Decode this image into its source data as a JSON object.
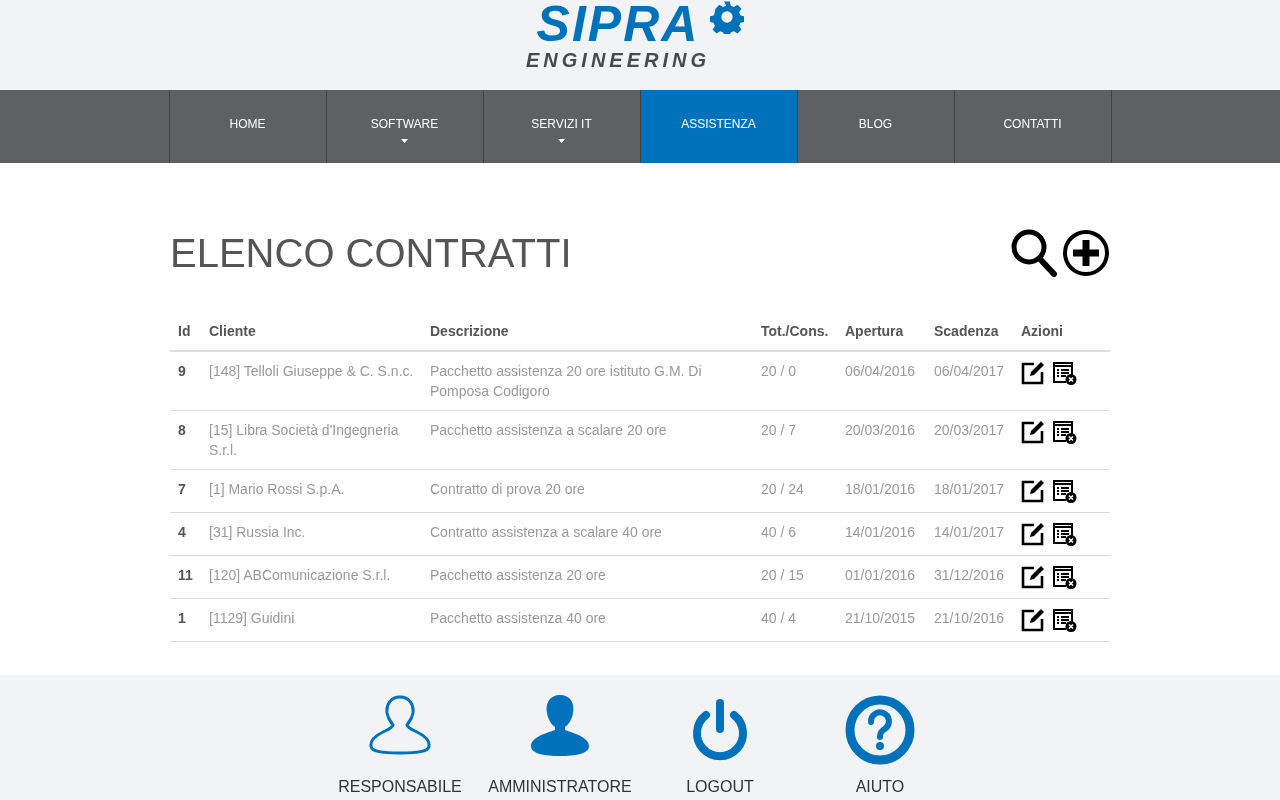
{
  "logo": {
    "name": "SIPRA",
    "tagline": "ENGINEERING"
  },
  "nav": [
    {
      "label": "HOME",
      "has_dropdown": false,
      "selected": false
    },
    {
      "label": "SOFTWARE",
      "has_dropdown": true,
      "selected": false
    },
    {
      "label": "SERVIZI IT",
      "has_dropdown": true,
      "selected": false
    },
    {
      "label": "ASSISTENZA",
      "has_dropdown": false,
      "selected": true
    },
    {
      "label": "BLOG",
      "has_dropdown": false,
      "selected": false
    },
    {
      "label": "CONTATTI",
      "has_dropdown": false,
      "selected": false
    }
  ],
  "page_title": "ELENCO CONTRATTI",
  "table": {
    "columns": [
      "Id",
      "Cliente",
      "Descrizione",
      "Tot./Cons.",
      "Apertura",
      "Scadenza",
      "Azioni"
    ],
    "rows": [
      {
        "id": "9",
        "cliente": "[148] Telloli Giuseppe & C. S.n.c.",
        "descrizione": "Pacchetto assistenza 20 ore istituto G.M. Di Pomposa Codigoro",
        "tot_cons": "20 / 0",
        "apertura": "06/04/2016",
        "scadenza": "06/04/2017"
      },
      {
        "id": "8",
        "cliente": "[15] Libra Società d'Ingegneria S.r.l.",
        "descrizione": "Pacchetto assistenza a scalare 20 ore",
        "tot_cons": "20 / 7",
        "apertura": "20/03/2016",
        "scadenza": "20/03/2017"
      },
      {
        "id": "7",
        "cliente": "[1] Mario Rossi S.p.A.",
        "descrizione": "Contratto di prova 20 ore",
        "tot_cons": "20 / 24",
        "apertura": "18/01/2016",
        "scadenza": "18/01/2017"
      },
      {
        "id": "4",
        "cliente": "[31] Russia Inc.",
        "descrizione": "Contratto assistenza a scalare 40 ore",
        "tot_cons": "40 / 6",
        "apertura": "14/01/2016",
        "scadenza": "14/01/2017"
      },
      {
        "id": "11",
        "cliente": "[120] ABComunicazione S.r.l.",
        "descrizione": "Pacchetto assistenza 20 ore",
        "tot_cons": "20 / 15",
        "apertura": "01/01/2016",
        "scadenza": "31/12/2016"
      },
      {
        "id": "1",
        "cliente": "[1129] Guidini",
        "descrizione": "Pacchetto assistenza 40 ore",
        "tot_cons": "40 / 4",
        "apertura": "21/10/2015",
        "scadenza": "21/10/2016"
      }
    ]
  },
  "footer": [
    {
      "label": "RESPONSABILE",
      "kind": "user-outline"
    },
    {
      "label": "AMMINISTRATORE",
      "kind": "user-solid"
    },
    {
      "label": "LOGOUT",
      "kind": "power"
    },
    {
      "label": "AIUTO",
      "kind": "help"
    }
  ]
}
